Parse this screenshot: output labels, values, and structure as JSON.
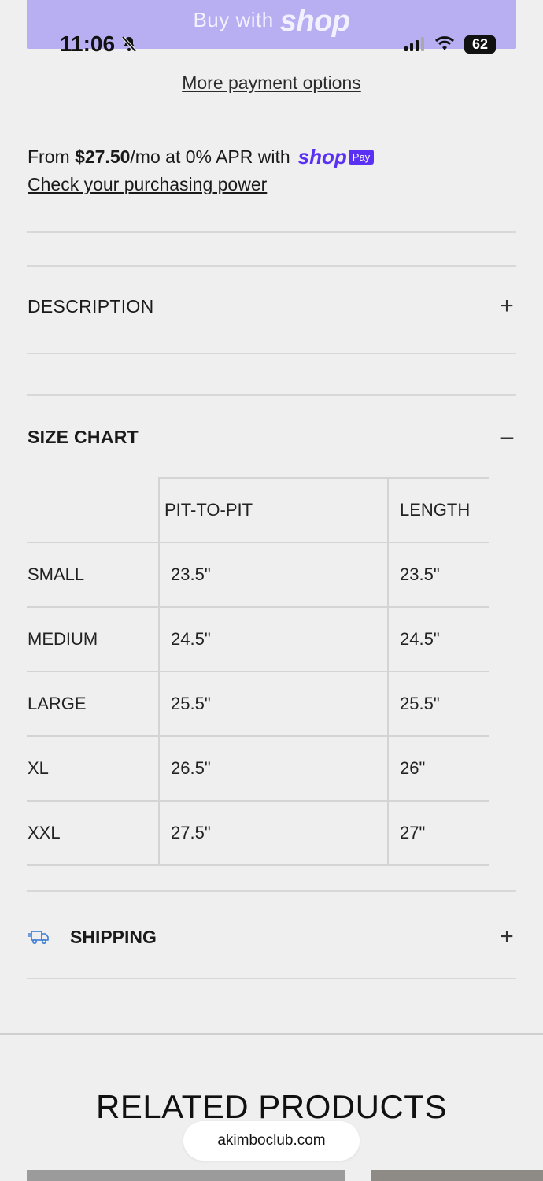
{
  "shop_button": {
    "prefix": "Buy with",
    "brand": "shop"
  },
  "status_bar": {
    "time": "11:06",
    "battery": "62"
  },
  "payment": {
    "more_options": "More payment options",
    "from_text": "From ",
    "amount": "$27.50",
    "after_amount": "/mo at 0% APR with",
    "shop_word": "shop",
    "pay_badge": "Pay",
    "check_power": "Check your purchasing power"
  },
  "accordion": {
    "description": "DESCRIPTION",
    "size_chart": "SIZE CHART",
    "shipping": "SHIPPING"
  },
  "size_table": {
    "headers": [
      "",
      "PIT-TO-PIT",
      "LENGTH"
    ],
    "rows": [
      [
        "SMALL",
        "23.5\"",
        "23.5\""
      ],
      [
        "MEDIUM",
        "24.5\"",
        "24.5\""
      ],
      [
        "LARGE",
        "25.5\"",
        "25.5\""
      ],
      [
        "XL",
        "26.5\"",
        "26\""
      ],
      [
        "XXL",
        "27.5\"",
        "27\""
      ]
    ]
  },
  "related": {
    "title": "RELATED PRODUCTS"
  },
  "browser": {
    "url": "akimboclub.com"
  },
  "colors": {
    "shop_button_bg": "#b8aef2",
    "shop_purple": "#5a31f4",
    "page_bg": "#efefef"
  },
  "icons": [
    "bell-slash-icon",
    "signal-icon",
    "wifi-icon",
    "battery-icon",
    "plus-icon",
    "minus-icon",
    "truck-icon"
  ]
}
